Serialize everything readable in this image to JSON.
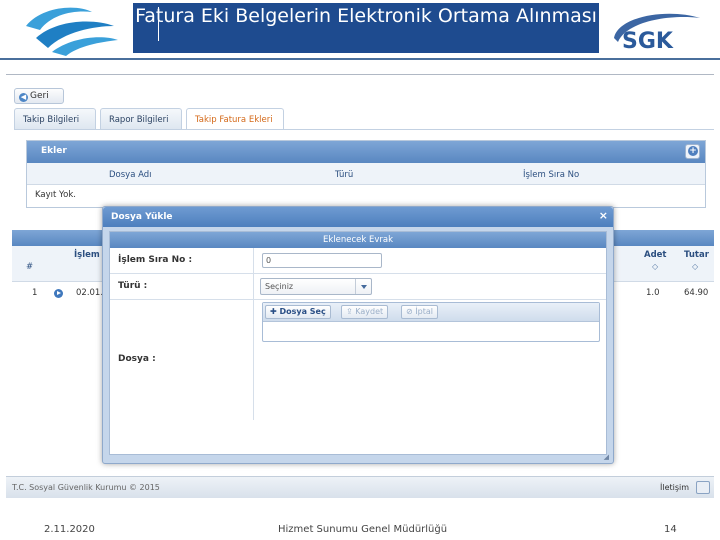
{
  "slide": {
    "title": "Fatura Eki Belgelerin Elektronik Ortama Alınması",
    "footer_date": "2.11.2020",
    "footer_center": "Hizmet Sunumu Genel Müdürlüğü",
    "footer_page": "14",
    "logo_right_text": "SGK"
  },
  "app": {
    "back_label": "Geri",
    "tabs": [
      {
        "label": "Takip Bilgileri",
        "active": false
      },
      {
        "label": "Rapor Bilgileri",
        "active": false
      },
      {
        "label": "Takip Fatura Ekleri",
        "active": true
      }
    ],
    "ekler": {
      "title": "Ekler",
      "columns": [
        "Dosya Adı",
        "Türü",
        "İşlem Sıra No"
      ],
      "empty_text": "Kayıt Yok."
    },
    "grid": {
      "columns": {
        "index": "#",
        "islem": "İşlem",
        "adet": "Adet",
        "tutar": "Tutar"
      },
      "rows": [
        {
          "index": "1",
          "islem": "02.01.2",
          "adet": "1.0",
          "tutar": "64.90"
        }
      ]
    },
    "footer": {
      "copyright": "T.C. Sosyal Güvenlik Kurumu © 2015",
      "contact": "İletişim"
    }
  },
  "modal": {
    "title": "Dosya Yükle",
    "section_title": "Eklenecek Evrak",
    "fields": {
      "islem_label": "İşlem Sıra No :",
      "islem_value": "0",
      "turu_label": "Türü :",
      "turu_value": "Seçiniz",
      "dosya_label": "Dosya :"
    },
    "buttons": {
      "select": "Dosya Seç",
      "save": "Kaydet",
      "cancel": "İptal"
    }
  },
  "colors": {
    "header_blue": "#1e4b8f",
    "grid_header": "#5987c1",
    "active_tab_text": "#d46a1a"
  }
}
